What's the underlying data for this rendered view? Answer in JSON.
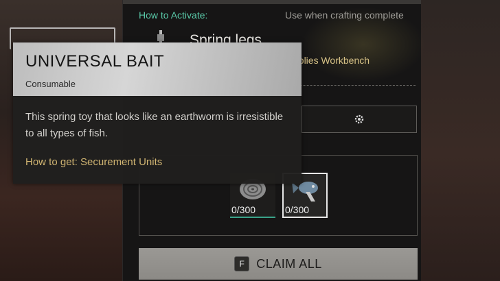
{
  "activation": {
    "label": "How to Activate:",
    "condition": "Use when crafting complete"
  },
  "item": {
    "title": "Spring legs",
    "source_partial": "pplies Workbench"
  },
  "rewards": [
    {
      "name": "coil-reward-icon",
      "count": "0/300"
    },
    {
      "name": "fish-reward-icon",
      "count": "0/300"
    }
  ],
  "claim": {
    "key": "F",
    "label": "CLAIM ALL"
  },
  "tooltip": {
    "name": "UNIVERSAL BAIT",
    "type": "Consumable",
    "description": "This spring toy that looks like an earthworm is irresistible to all types of fish.",
    "how_to_get": "How to get: Securement Units"
  },
  "colors": {
    "accent_teal": "#59c9a8",
    "accent_gold": "#d1b572"
  }
}
